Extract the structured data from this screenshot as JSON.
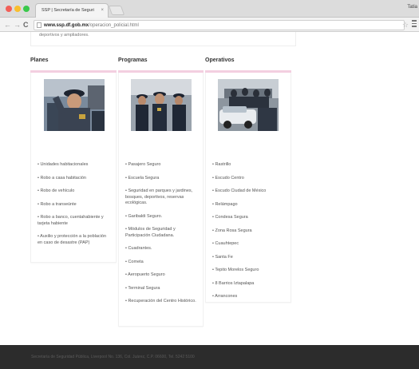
{
  "browser": {
    "tab_title": "SSP | Secretaría de Seguri",
    "tab_close": "×",
    "profile_label": "Tatia",
    "url_host": "www.ssp.df.gob.mx",
    "url_path": "/operacion_policial.html",
    "icons": [
      "back-arrow-icon",
      "forward-arrow-icon",
      "reload-icon",
      "page-icon",
      "star-icon",
      "menu-icon"
    ]
  },
  "page": {
    "top_card_text": "deportivos y ampliadores.",
    "accent_color": "#f3cfe0",
    "columns": [
      {
        "heading": "Planes",
        "items": [
          "• Unidades habitacionales",
          "• Robo a casa habitación",
          "• Robo de vehículo",
          "• Robo a transeúnte",
          "• Robo a banco, cuentahabiente y tarjeta habiente",
          "• Auxilio y protección a la población en caso de desastre (PAP)"
        ]
      },
      {
        "heading": "Programas",
        "items": [
          "• Pasajero Seguro",
          "• Escuela Segura",
          "• Seguridad en parques y jardines, bosques, deportivos, reservas ecológicas.",
          "• Garibaldi Seguro.",
          "• Módulos de Seguridad y Participación Ciudadana.",
          "• Cuadrantes.",
          "• Cometa",
          "• Aeropuerto Seguro",
          "• Terminal Segura",
          "• Recuperación del Centro Histórico."
        ]
      },
      {
        "heading": "Operativos",
        "items": [
          "• Rastrillo",
          "• Escudo Centro",
          "• Escudo Ciudad de México",
          "• Relámpago",
          "• Condesa Segura",
          "• Zona Rosa Segura",
          "• Cuauhtepec",
          "• Santa Fe",
          "• Tepito Morelos Seguro",
          "• 8 Barrios Iztapalapa",
          "• Arrancones"
        ]
      }
    ],
    "footer_text": "Secretaría de Seguridad Pública, Liverpool No. 136, Col. Juárez, C.P. 06600, Tel. 5242 5100"
  }
}
